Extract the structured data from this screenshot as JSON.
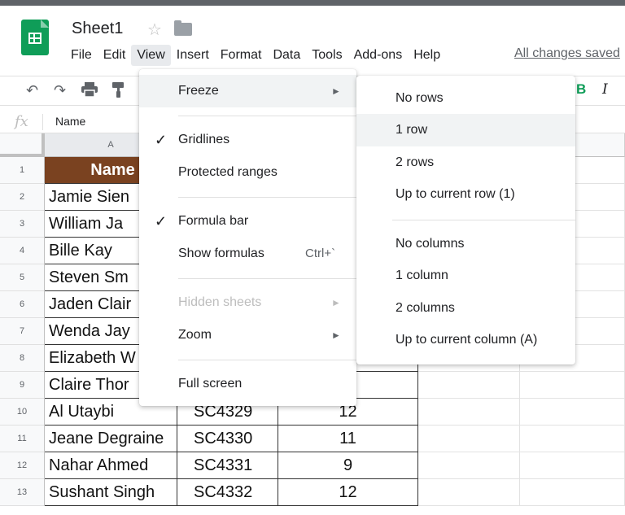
{
  "app": {
    "title": "Sheet1",
    "saved_status": "All changes saved"
  },
  "menubar": [
    "File",
    "Edit",
    "View",
    "Insert",
    "Format",
    "Data",
    "Tools",
    "Add-ons",
    "Help"
  ],
  "toolbar": {
    "icons": [
      "undo-icon",
      "redo-icon",
      "print-icon",
      "paint-format-icon"
    ],
    "bold_label": "B",
    "italic_label": "I"
  },
  "formula_bar": {
    "fx_label": "fx",
    "value": "Name"
  },
  "sheet": {
    "visible_column_header": "A",
    "rows": [
      {
        "num": "1",
        "a": "Name",
        "b": "",
        "c": ""
      },
      {
        "num": "2",
        "a": "Jamie Sien",
        "b": "",
        "c": ""
      },
      {
        "num": "3",
        "a": "William Ja",
        "b": "",
        "c": ""
      },
      {
        "num": "4",
        "a": "Bille Kay",
        "b": "",
        "c": ""
      },
      {
        "num": "5",
        "a": "Steven Sm",
        "b": "",
        "c": ""
      },
      {
        "num": "6",
        "a": "Jaden Clair",
        "b": "",
        "c": ""
      },
      {
        "num": "7",
        "a": "Wenda Jay",
        "b": "",
        "c": ""
      },
      {
        "num": "8",
        "a": "Elizabeth W",
        "b": "",
        "c": ""
      },
      {
        "num": "9",
        "a": "Claire Thor",
        "b": "",
        "c": ""
      },
      {
        "num": "10",
        "a": "Al Utaybi",
        "b": "SC4329",
        "c": "12"
      },
      {
        "num": "11",
        "a": "Jeane Degraine",
        "b": "SC4330",
        "c": "11"
      },
      {
        "num": "12",
        "a": "Nahar Ahmed",
        "b": "SC4331",
        "c": "9"
      },
      {
        "num": "13",
        "a": "Sushant Singh",
        "b": "SC4332",
        "c": "12"
      }
    ]
  },
  "view_menu": {
    "freeze": "Freeze",
    "gridlines": "Gridlines",
    "protected_ranges": "Protected ranges",
    "formula_bar": "Formula bar",
    "show_formulas": "Show formulas",
    "show_formulas_shortcut": "Ctrl+`",
    "hidden_sheets": "Hidden sheets",
    "zoom": "Zoom",
    "full_screen": "Full screen",
    "check_mark": "✓",
    "submenu_arrow": "►"
  },
  "freeze_menu": {
    "no_rows": "No rows",
    "one_row": "1 row",
    "two_rows": "2 rows",
    "up_to_row": "Up to current row (1)",
    "no_columns": "No columns",
    "one_column": "1 column",
    "two_columns": "2 columns",
    "up_to_column": "Up to current column (A)"
  },
  "colors": {
    "brand_green": "#0f9d58",
    "header_fill": "#7a4220",
    "menu_highlight": "#f1f3f4"
  }
}
